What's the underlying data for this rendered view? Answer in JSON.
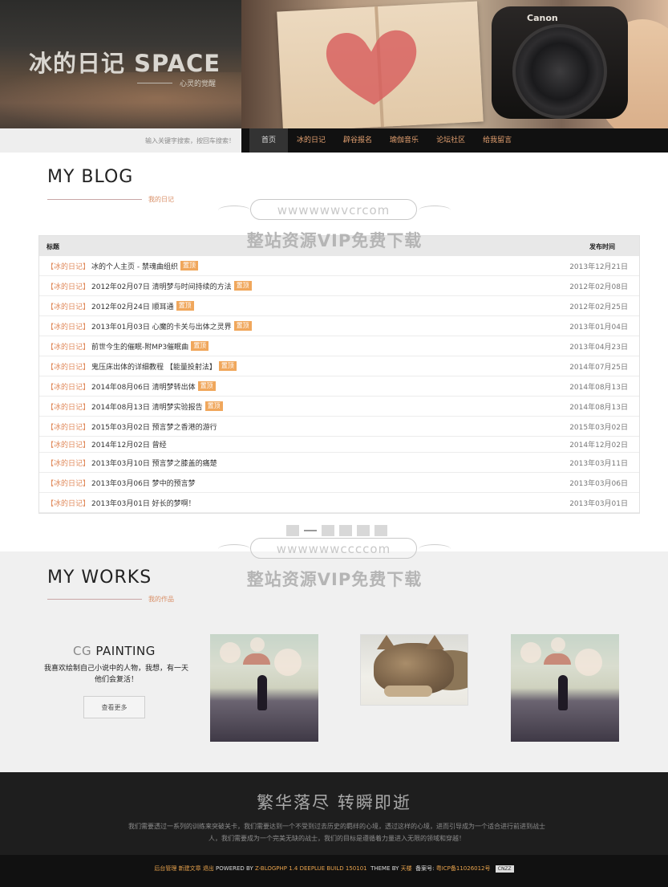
{
  "header": {
    "site_title": "冰的日记 SPACE",
    "site_subtitle": "心灵的觉醒",
    "banner_brand": "Canon",
    "search_placeholder": "输入关键字搜索，按回车搜索！",
    "nav": [
      "首页",
      "冰的日记",
      "辟谷报名",
      "瑜伽音乐",
      "论坛社区",
      "给我留言"
    ],
    "nav_active_index": 0
  },
  "blog": {
    "heading": "MY BLOG",
    "subheading": "我的日记",
    "col_title": "标题",
    "col_date": "发布时间",
    "rows": [
      {
        "cat": "【冰的日记】",
        "title": "冰的个人主页 - 禁魂曲组织",
        "tag": "置顶",
        "date": "2013年12月21日"
      },
      {
        "cat": "【冰的日记】",
        "title": "2012年02月07日 清明梦与时间持续的方法",
        "tag": "置顶",
        "date": "2012年02月08日"
      },
      {
        "cat": "【冰的日记】",
        "title": "2012年02月24日 顺耳通",
        "tag": "置顶",
        "date": "2012年02月25日"
      },
      {
        "cat": "【冰的日记】",
        "title": "2013年01月03日 心魔的卡关与出体之灵界",
        "tag": "置顶",
        "date": "2013年01月04日"
      },
      {
        "cat": "【冰的日记】",
        "title": "前世今生的催眠-附MP3催眠曲",
        "tag": "置顶",
        "date": "2013年04月23日"
      },
      {
        "cat": "【冰的日记】",
        "title": "鬼压床出体的详细教程 【能量投射法】",
        "tag": "置顶",
        "date": "2014年07月25日"
      },
      {
        "cat": "【冰的日记】",
        "title": "2014年08月06日 清明梦转出体",
        "tag": "置顶",
        "date": "2014年08月13日"
      },
      {
        "cat": "【冰的日记】",
        "title": "2014年08月13日 清明梦实验报告",
        "tag": "置顶",
        "date": "2014年08月13日"
      },
      {
        "cat": "【冰的日记】",
        "title": "2015年03月02日 预言梦之香港的游行",
        "tag": "",
        "date": "2015年03月02日"
      },
      {
        "cat": "【冰的日记】",
        "title": "2014年12月02日 曾经",
        "tag": "",
        "date": "2014年12月02日"
      },
      {
        "cat": "【冰的日记】",
        "title": "2013年03月10日 预言梦之膝盖的痛楚",
        "tag": "",
        "date": "2013年03月11日"
      },
      {
        "cat": "【冰的日记】",
        "title": "2013年03月06日 梦中的预言梦",
        "tag": "",
        "date": "2013年03月06日"
      },
      {
        "cat": "【冰的日记】",
        "title": "2013年03月01日 好长的梦啊！",
        "tag": "",
        "date": "2013年03月01日"
      }
    ]
  },
  "works": {
    "heading": "MY WORKS",
    "subheading": "我的作品",
    "cg_prefix": "CG",
    "cg_title": "PAINTING",
    "cg_desc": "我喜欢绘制自己小说中的人物，我想，有一天他们会复活！",
    "more_label": "查看更多"
  },
  "footer": {
    "title": "繁华落尽 转瞬即逝",
    "text": "我们需要透过一系列的训练来突破关卡，我们需要达到一个不受到过去历史的羁绊的心境，透过这样的心境，进而引导成为一个适合进行前进到战士人，我们需要成为一个完美无缺的战士，我们的目标是遵循着力量进入无限的领域和穿越！",
    "bottom": {
      "admin": "后台管理",
      "new_post": "新建文章",
      "logout": "退出",
      "powered_prefix": "POWERED BY",
      "powered_link": "Z-BLOGPHP 1.4 DEEPLUE BUILD 150101",
      "theme_prefix": "THEME BY",
      "theme_author": "天楼",
      "icp_label": "备案号:",
      "icp": "粤ICP备11026012号",
      "badge": "CNZZ"
    }
  },
  "watermark": {
    "url_top": "wwwwwwvcrcom",
    "url_bottom": "wwwwwwccccom",
    "text": "整站资源VIP免费下载"
  },
  "colors": {
    "accent": "#e0895a",
    "tag_bg": "#f0a75c",
    "nav_bg": "#111111",
    "footer_bg": "#1e1e1e"
  }
}
